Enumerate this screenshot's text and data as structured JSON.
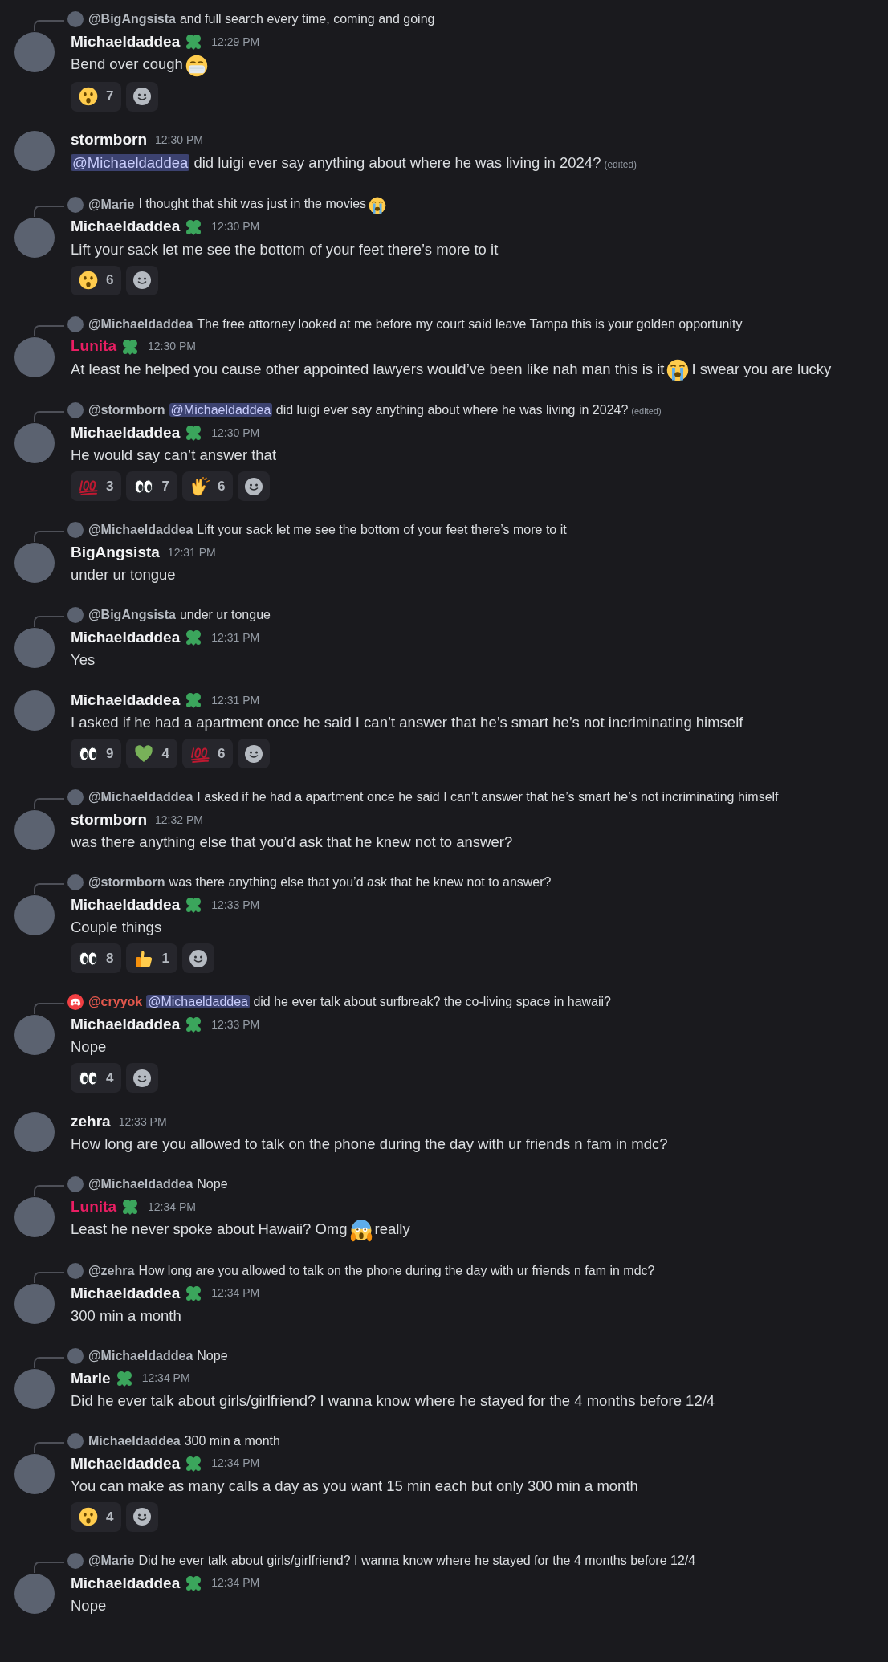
{
  "messages": [
    {
      "reply": {
        "kind": "user",
        "author": {
          "name": "@BigAngsista",
          "color": "#b5bac1"
        },
        "content": [
          {
            "kind": "text",
            "text": "and full search every time, coming and going"
          }
        ]
      },
      "author": {
        "name": "Michaeldaddea",
        "color": "#f2f3f5",
        "badge": true
      },
      "time": "12:29 PM",
      "content": [
        {
          "kind": "text",
          "text": "Bend over cough"
        },
        {
          "kind": "mask"
        }
      ],
      "reactions": [
        {
          "kind": "hushed",
          "count": "7"
        }
      ]
    },
    {
      "author": {
        "name": "stormborn",
        "color": "#f2f3f5",
        "badge": false
      },
      "time": "12:30 PM",
      "content": [
        {
          "kind": "mention",
          "text": "@Michaeldaddea"
        },
        {
          "kind": "text",
          "text": " did luigi ever say anything about where he was living in 2024?"
        },
        {
          "kind": "edited",
          "text": "(edited)"
        }
      ]
    },
    {
      "reply": {
        "kind": "user",
        "author": {
          "name": "@Marie",
          "color": "#b5bac1"
        },
        "content": [
          {
            "kind": "text",
            "text": "I thought that shit was just in the movies"
          },
          {
            "kind": "sob"
          }
        ]
      },
      "author": {
        "name": "Michaeldaddea",
        "color": "#f2f3f5",
        "badge": true
      },
      "time": "12:30 PM",
      "content": [
        {
          "kind": "text",
          "text": "Lift your sack let me see the bottom of your feet there’s more to it"
        }
      ],
      "reactions": [
        {
          "kind": "hushed",
          "count": "6"
        }
      ]
    },
    {
      "reply": {
        "kind": "user",
        "author": {
          "name": "@Michaeldaddea",
          "color": "#b5bac1"
        },
        "content": [
          {
            "kind": "text",
            "text": "The free attorney looked at me before my court said leave Tampa this is your golden opportunity"
          }
        ]
      },
      "author": {
        "name": "Lunita",
        "color": "#e91e63",
        "badge": true
      },
      "time": "12:30 PM",
      "content": [
        {
          "kind": "text",
          "text": "At least he helped you cause other appointed lawyers would’ve been like nah man this is it"
        },
        {
          "kind": "sob"
        },
        {
          "kind": "text",
          "text": "I swear you are lucky"
        }
      ]
    },
    {
      "reply": {
        "kind": "user",
        "author": {
          "name": "@stormborn",
          "color": "#b5bac1"
        },
        "content": [
          {
            "kind": "mention",
            "text": "@Michaeldaddea"
          },
          {
            "kind": "text",
            "text": " did luigi ever say anything about where he was living in 2024?"
          },
          {
            "kind": "edited",
            "text": "(edited)"
          }
        ]
      },
      "author": {
        "name": "Michaeldaddea",
        "color": "#f2f3f5",
        "badge": true
      },
      "time": "12:30 PM",
      "content": [
        {
          "kind": "text",
          "text": "He would say can’t answer that"
        }
      ],
      "reactions": [
        {
          "kind": "hundred",
          "count": "3"
        },
        {
          "kind": "eyes",
          "count": "7"
        },
        {
          "kind": "clap",
          "count": "6"
        }
      ]
    },
    {
      "reply": {
        "kind": "user",
        "author": {
          "name": "@Michaeldaddea",
          "color": "#b5bac1"
        },
        "content": [
          {
            "kind": "text",
            "text": "Lift your sack let me see the bottom of your feet there’s more to it"
          }
        ]
      },
      "author": {
        "name": "BigAngsista",
        "color": "#f2f3f5",
        "badge": false
      },
      "time": "12:31 PM",
      "content": [
        {
          "kind": "text",
          "text": "under ur tongue"
        }
      ]
    },
    {
      "reply": {
        "kind": "user",
        "author": {
          "name": "@BigAngsista",
          "color": "#b5bac1"
        },
        "content": [
          {
            "kind": "text",
            "text": "under ur tongue"
          }
        ]
      },
      "author": {
        "name": "Michaeldaddea",
        "color": "#f2f3f5",
        "badge": true
      },
      "time": "12:31 PM",
      "content": [
        {
          "kind": "text",
          "text": "Yes"
        }
      ]
    },
    {
      "author": {
        "name": "Michaeldaddea",
        "color": "#f2f3f5",
        "badge": true
      },
      "time": "12:31 PM",
      "content": [
        {
          "kind": "text",
          "text": "I asked if he had a apartment once he said I can’t answer that he’s smart he’s not incriminating himself"
        }
      ],
      "reactions": [
        {
          "kind": "eyes",
          "count": "9"
        },
        {
          "kind": "heart",
          "count": "4"
        },
        {
          "kind": "hundred",
          "count": "6"
        }
      ]
    },
    {
      "reply": {
        "kind": "user",
        "author": {
          "name": "@Michaeldaddea",
          "color": "#b5bac1"
        },
        "content": [
          {
            "kind": "text",
            "text": "I asked if he had a apartment once he said I can’t answer that he’s smart he’s not incriminating himself"
          }
        ]
      },
      "author": {
        "name": "stormborn",
        "color": "#f2f3f5",
        "badge": false
      },
      "time": "12:32 PM",
      "content": [
        {
          "kind": "text",
          "text": "was there anything else that you’d ask that he knew not to answer?"
        }
      ]
    },
    {
      "reply": {
        "kind": "user",
        "author": {
          "name": "@stormborn",
          "color": "#b5bac1"
        },
        "content": [
          {
            "kind": "text",
            "text": "was there anything else that you’d ask that he knew not to answer?"
          }
        ]
      },
      "author": {
        "name": "Michaeldaddea",
        "color": "#f2f3f5",
        "badge": true
      },
      "time": "12:33 PM",
      "content": [
        {
          "kind": "text",
          "text": "Couple things"
        }
      ],
      "reactions": [
        {
          "kind": "eyes",
          "count": "8"
        },
        {
          "kind": "thumbsup",
          "count": "1"
        }
      ]
    },
    {
      "reply": {
        "kind": "app",
        "author": {
          "name": "@cryyok",
          "color": "#e0574c"
        },
        "content": [
          {
            "kind": "mention",
            "text": "@Michaeldaddea"
          },
          {
            "kind": "text",
            "text": " did he ever talk about surfbreak? the co-living space in hawaii?"
          }
        ]
      },
      "author": {
        "name": "Michaeldaddea",
        "color": "#f2f3f5",
        "badge": true
      },
      "time": "12:33 PM",
      "content": [
        {
          "kind": "text",
          "text": "Nope"
        }
      ],
      "reactions": [
        {
          "kind": "eyes",
          "count": "4"
        }
      ]
    },
    {
      "author": {
        "name": "zehra",
        "color": "#f2f3f5",
        "badge": false
      },
      "time": "12:33 PM",
      "content": [
        {
          "kind": "text",
          "text": "How long are you allowed to talk on the phone during the day with ur friends n fam in mdc?"
        }
      ]
    },
    {
      "reply": {
        "kind": "user",
        "author": {
          "name": "@Michaeldaddea",
          "color": "#b5bac1"
        },
        "content": [
          {
            "kind": "text",
            "text": "Nope"
          }
        ]
      },
      "author": {
        "name": "Lunita",
        "color": "#e91e63",
        "badge": true
      },
      "time": "12:34 PM",
      "content": [
        {
          "kind": "text",
          "text": "Least he never spoke about Hawaii? Omg"
        },
        {
          "kind": "scream"
        },
        {
          "kind": "text",
          "text": "really"
        }
      ]
    },
    {
      "reply": {
        "kind": "user",
        "author": {
          "name": "@zehra",
          "color": "#b5bac1"
        },
        "content": [
          {
            "kind": "text",
            "text": "How long are you allowed to talk on the phone during the day with ur friends n fam in mdc?"
          }
        ]
      },
      "author": {
        "name": "Michaeldaddea",
        "color": "#f2f3f5",
        "badge": true
      },
      "time": "12:34 PM",
      "content": [
        {
          "kind": "text",
          "text": "300 min a month"
        }
      ]
    },
    {
      "reply": {
        "kind": "user",
        "author": {
          "name": "@Michaeldaddea",
          "color": "#b5bac1"
        },
        "content": [
          {
            "kind": "text",
            "text": "Nope"
          }
        ]
      },
      "author": {
        "name": "Marie",
        "color": "#f2f3f5",
        "badge": true
      },
      "time": "12:34 PM",
      "content": [
        {
          "kind": "text",
          "text": "Did he ever talk about girls/girlfriend? I wanna know where he stayed for the 4 months before 12/4"
        }
      ]
    },
    {
      "reply": {
        "kind": "user",
        "author": {
          "name": "Michaeldaddea",
          "color": "#b5bac1"
        },
        "content": [
          {
            "kind": "text",
            "text": "300 min a month"
          }
        ]
      },
      "author": {
        "name": "Michaeldaddea",
        "color": "#f2f3f5",
        "badge": true
      },
      "time": "12:34 PM",
      "content": [
        {
          "kind": "text",
          "text": "You can make as many calls a day as you want 15 min each but only 300 min a month"
        }
      ],
      "reactions": [
        {
          "kind": "hushed",
          "count": "4"
        }
      ]
    },
    {
      "reply": {
        "kind": "user",
        "author": {
          "name": "@Marie",
          "color": "#b5bac1"
        },
        "content": [
          {
            "kind": "text",
            "text": "Did he ever talk about girls/girlfriend? I wanna know where he stayed for the 4 months before 12/4"
          }
        ]
      },
      "author": {
        "name": "Michaeldaddea",
        "color": "#f2f3f5",
        "badge": true
      },
      "time": "12:34 PM",
      "content": [
        {
          "kind": "text",
          "text": "Nope"
        }
      ]
    }
  ]
}
